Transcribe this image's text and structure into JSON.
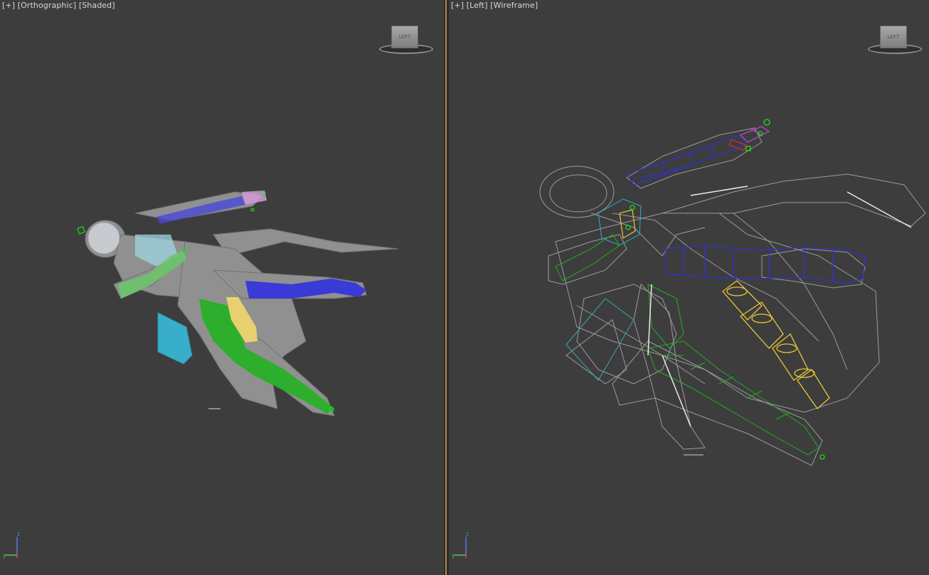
{
  "viewports": [
    {
      "label_plus": "[+]",
      "label_view": "[Orthographic]",
      "label_mode": "[Shaded]",
      "viewcube_face": "LEFT",
      "axis": {
        "z": "z",
        "y": "y",
        "x": "x"
      }
    },
    {
      "label_plus": "[+]",
      "label_view": "[Left]",
      "label_mode": "[Wireframe]",
      "viewcube_face": "LEFT",
      "axis": {
        "z": "z",
        "y": "y",
        "x": "x"
      }
    }
  ],
  "colors": {
    "viewport_bg": "#3d3d3d",
    "active_border": "#b48a3c",
    "bone_blue": "#3a3ad6",
    "bone_green": "#22b222",
    "bone_yellow": "#e8d070",
    "bone_cyan": "#38b8d0",
    "mesh_gray": "#c8c8c8"
  }
}
